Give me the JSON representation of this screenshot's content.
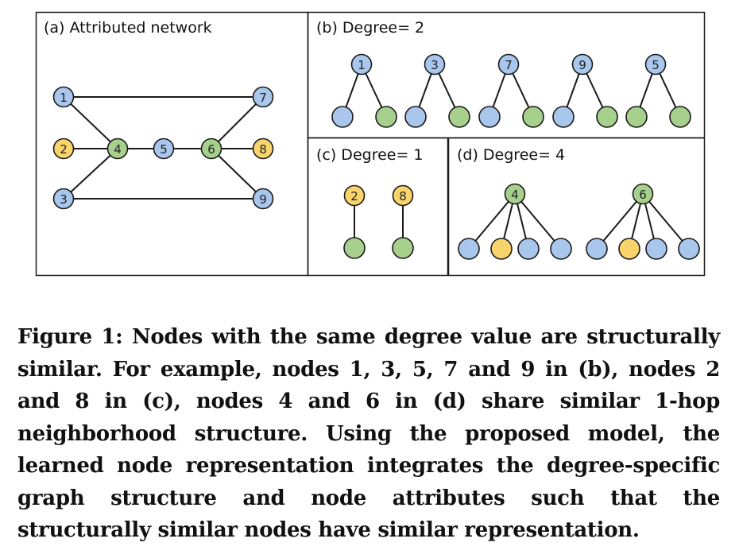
{
  "colors": {
    "blue": "#a9c6ec",
    "green": "#a8d08d",
    "yellow": "#f9d46d",
    "stroke": "#1a1a1a"
  },
  "panel_a": {
    "label": "(a) Attributed network",
    "nodes": [
      {
        "id": "n1",
        "label": "1",
        "color": "blue"
      },
      {
        "id": "n2",
        "label": "2",
        "color": "yellow"
      },
      {
        "id": "n3",
        "label": "3",
        "color": "blue"
      },
      {
        "id": "n4",
        "label": "4",
        "color": "green"
      },
      {
        "id": "n5",
        "label": "5",
        "color": "blue"
      },
      {
        "id": "n6",
        "label": "6",
        "color": "green"
      },
      {
        "id": "n7",
        "label": "7",
        "color": "blue"
      },
      {
        "id": "n8",
        "label": "8",
        "color": "yellow"
      },
      {
        "id": "n9",
        "label": "9",
        "color": "blue"
      }
    ],
    "edges": [
      [
        "n1",
        "n7"
      ],
      [
        "n3",
        "n9"
      ],
      [
        "n1",
        "n4"
      ],
      [
        "n2",
        "n4"
      ],
      [
        "n3",
        "n4"
      ],
      [
        "n4",
        "n5"
      ],
      [
        "n5",
        "n6"
      ],
      [
        "n6",
        "n7"
      ],
      [
        "n6",
        "n8"
      ],
      [
        "n6",
        "n9"
      ]
    ]
  },
  "panel_b": {
    "label": "(b) Degree= 2",
    "groups": [
      {
        "root": "1",
        "root_color": "blue",
        "children": [
          "blue",
          "green"
        ]
      },
      {
        "root": "3",
        "root_color": "blue",
        "children": [
          "blue",
          "green"
        ]
      },
      {
        "root": "7",
        "root_color": "blue",
        "children": [
          "blue",
          "green"
        ]
      },
      {
        "root": "9",
        "root_color": "blue",
        "children": [
          "blue",
          "green"
        ]
      },
      {
        "root": "5",
        "root_color": "blue",
        "children": [
          "green",
          "green"
        ]
      }
    ]
  },
  "panel_c": {
    "label": "(c) Degree= 1",
    "groups": [
      {
        "root": "2",
        "root_color": "yellow",
        "children": [
          "green"
        ]
      },
      {
        "root": "8",
        "root_color": "yellow",
        "children": [
          "green"
        ]
      }
    ]
  },
  "panel_d": {
    "label": "(d) Degree= 4",
    "groups": [
      {
        "root": "4",
        "root_color": "green",
        "children": [
          "blue",
          "yellow",
          "blue",
          "blue"
        ]
      },
      {
        "root": "6",
        "root_color": "green",
        "children": [
          "blue",
          "yellow",
          "blue",
          "blue"
        ]
      }
    ]
  },
  "caption": {
    "text": "Figure 1: Nodes with the same degree value are structurally similar. For example, nodes 1, 3, 5, 7 and 9 in (b), nodes 2 and 8 in (c), nodes 4 and 6 in (d) share similar 1-hop neighborhood structure. Using the proposed model, the learned node representation integrates the degree-specific graph structure and node attributes such that the structurally similar nodes have similar representation."
  }
}
